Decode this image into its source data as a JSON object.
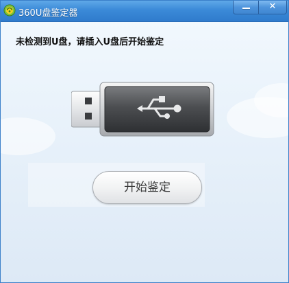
{
  "window": {
    "title": "360U盘鉴定器",
    "app_icon": "360-logo-icon",
    "minimize_icon": "minimize-icon",
    "close_label": "✕",
    "close_icon": "close-icon"
  },
  "main": {
    "message": "未检测到U盘，请插入U盘后开始鉴定",
    "usb_icon": "usb-drive-icon",
    "start_button_label": "开始鉴定"
  },
  "colors": {
    "titlebar": "#3b8ad8",
    "background": "#eaf3fb",
    "button_text": "#3a3a3a"
  }
}
